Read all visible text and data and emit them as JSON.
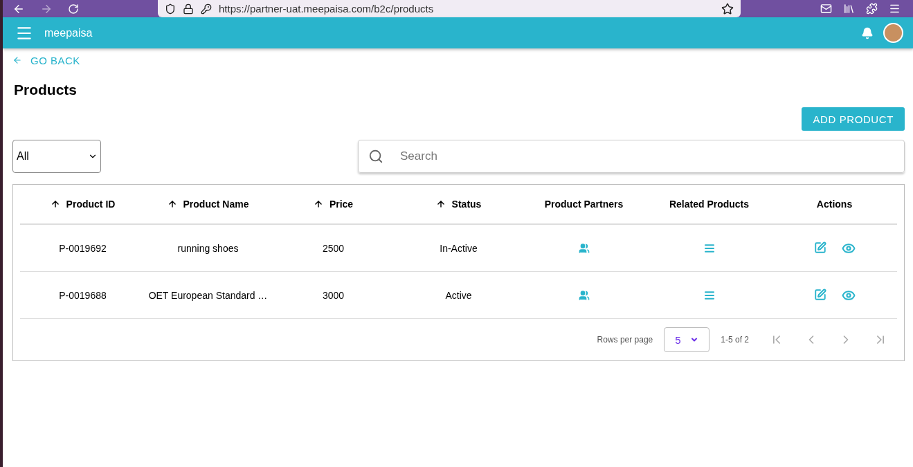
{
  "browser": {
    "url": "https://partner-uat.meepaisa.com/b2c/products"
  },
  "app_bar": {
    "title": "meepaisa"
  },
  "go_back": "GO BACK",
  "page_title": "Products",
  "add_button": "ADD PRODUCT",
  "filter": {
    "value": "All"
  },
  "search": {
    "placeholder": "Search"
  },
  "table": {
    "columns": [
      {
        "label": "Product ID",
        "sortable": true
      },
      {
        "label": "Product Name",
        "sortable": true
      },
      {
        "label": "Price",
        "sortable": true
      },
      {
        "label": "Status",
        "sortable": true
      },
      {
        "label": "Product Partners",
        "sortable": false
      },
      {
        "label": "Related Products",
        "sortable": false
      },
      {
        "label": "Actions",
        "sortable": false
      }
    ],
    "rows": [
      {
        "id": "P-0019692",
        "name": "running shoes",
        "price": "2500",
        "status": "In-Active"
      },
      {
        "id": "P-0019688",
        "name": "OET European Standard …",
        "price": "3000",
        "status": "Active"
      }
    ]
  },
  "pagination": {
    "rows_label": "Rows per page",
    "rows_value": "5",
    "range": "1-5 of 2",
    "first_disabled": true,
    "prev_disabled": true,
    "next_disabled": true,
    "last_disabled": true
  }
}
